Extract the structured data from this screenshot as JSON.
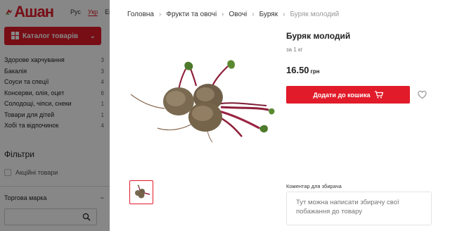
{
  "site": {
    "logo_text": "Ашан",
    "languages": [
      "Рус",
      "Укр",
      "Eng"
    ],
    "active_language": "Укр"
  },
  "sidebar": {
    "catalog_label": "Каталог товарів",
    "categories": [
      {
        "label": "Здорове харчування",
        "count": "3"
      },
      {
        "label": "Бакалія",
        "count": "3"
      },
      {
        "label": "Соуси та спеції",
        "count": "4"
      },
      {
        "label": "Консерви, олія, оцет",
        "count": "6"
      },
      {
        "label": "Солодощі, чіпси, снеки",
        "count": "1"
      },
      {
        "label": "Товари для дітей",
        "count": "1"
      },
      {
        "label": "Хобі та відпочинок",
        "count": "4"
      }
    ],
    "filters_title": "Фільтри",
    "promo_filter_label": "Акційні товари",
    "brand_title": "Торгова марка",
    "brand_toggle": "−"
  },
  "modal": {
    "breadcrumb": [
      "Головна",
      "Фрукти та овочі",
      "Овочі",
      "Буряк",
      "Буряк молодий"
    ],
    "title": "Буряк молодий",
    "unit": "за 1 кг",
    "price": "16.50",
    "currency": "грн",
    "add_to_cart_label": "Додати до кошика",
    "comment_label": "Коментар для збирача",
    "comment_placeholder": "Тут можна написати збирачу свої побажання до товару",
    "product_image_icon": "beetroot-image",
    "colors": {
      "brand_red": "#e11b2a",
      "overlay": "rgba(0,0,0,0.47)"
    }
  }
}
